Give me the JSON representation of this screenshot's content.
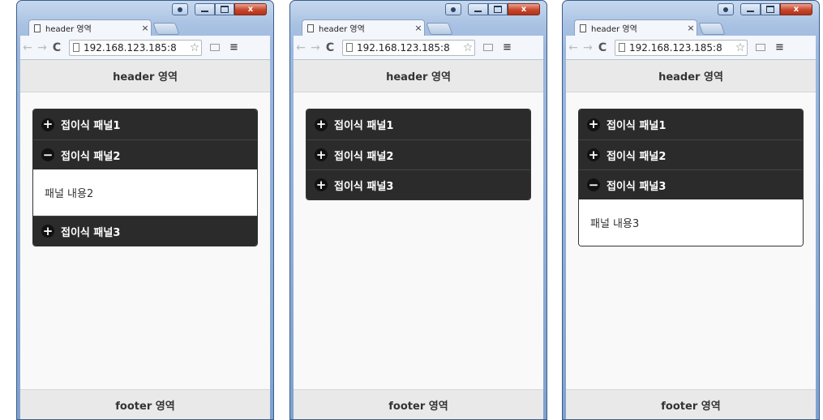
{
  "browser": {
    "tab_title": "header 영역",
    "tab_close": "×",
    "url": "192.168.123.185:8",
    "controls": {
      "minimize": "—",
      "maximize": "□",
      "close": "x"
    },
    "nav": {
      "back": "←",
      "forward": "→",
      "reload": "C",
      "star": "☆",
      "menu": "≡"
    }
  },
  "page": {
    "header": "header 영역",
    "footer": "footer 영역"
  },
  "windows": [
    {
      "panels": [
        {
          "title": "접이식 패널1",
          "icon": "+"
        },
        {
          "title": "접이식 패널2",
          "icon": "−",
          "content": "패널 내용2"
        },
        {
          "title": "접이식 패널3",
          "icon": "+"
        }
      ]
    },
    {
      "panels": [
        {
          "title": "접이식 패널1",
          "icon": "+"
        },
        {
          "title": "접이식 패널2",
          "icon": "+"
        },
        {
          "title": "접이식 패널3",
          "icon": "+"
        }
      ]
    },
    {
      "panels": [
        {
          "title": "접이식 패널1",
          "icon": "+"
        },
        {
          "title": "접이식 패널2",
          "icon": "+"
        },
        {
          "title": "접이식 패널3",
          "icon": "−",
          "content": "패널 내용3"
        }
      ]
    }
  ],
  "icons": {
    "expand": "plus-icon",
    "collapse": "minus-icon",
    "colors": {
      "panel_header": "#2b2b2b",
      "page_bg": "#f9f9f9",
      "header_bg": "#e9e9e9"
    }
  }
}
